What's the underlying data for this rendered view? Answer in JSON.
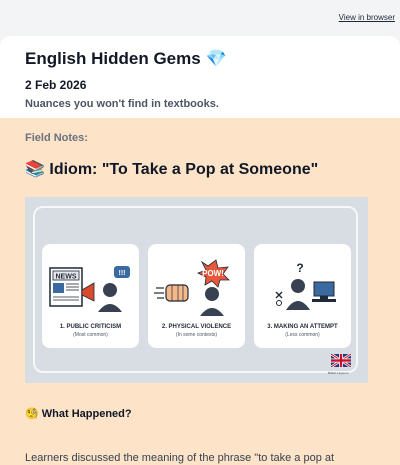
{
  "browser": {
    "view_link": "View in browser"
  },
  "newsletter": {
    "title": "English Hidden Gems",
    "title_emoji": "💎",
    "date": "2 Feb 2026",
    "tagline": "Nuances you won't find in textbooks."
  },
  "section": {
    "label": "Field Notes:",
    "idiom_emoji": "📚",
    "idiom_title": "Idiom: \"To Take a Pop at Someone\""
  },
  "illustration": {
    "panels": [
      {
        "title": "1. PUBLIC CRITICISM",
        "subtitle": "(Most common)",
        "icon": "newspaper-megaphone-icon",
        "sign_text": "NEWS"
      },
      {
        "title": "2. PHYSICAL VIOLENCE",
        "subtitle": "(In some contexts)",
        "icon": "fist-punch-icon",
        "sign_text": "POW!"
      },
      {
        "title": "3. MAKING AN ATTEMPT",
        "subtitle": "(Less common)",
        "icon": "person-computer-icon",
        "sign_text": "?"
      }
    ],
    "flag": "uk-flag-icon",
    "flag_caption": "British Lingo.co"
  },
  "what_happened": {
    "emoji": "🧐",
    "heading": "What Happened?"
  },
  "body": {
    "first_line": "Learners discussed the meaning of the phrase \"to take a pop at"
  },
  "colors": {
    "card_bg": "#fde3c7",
    "header_bg": "#ffffff",
    "page_bg": "#f3f4f6"
  }
}
